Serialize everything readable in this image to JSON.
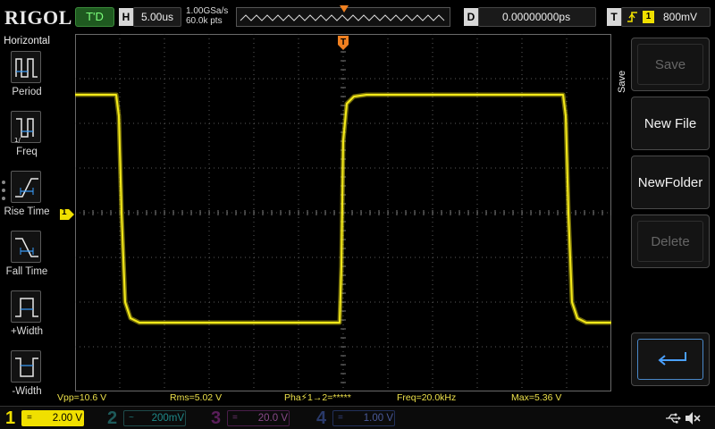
{
  "brand": {
    "logo": "RIGOL"
  },
  "topbar": {
    "run_state": "T'D",
    "timebase_tag": "H",
    "timebase_value": "5.00us",
    "sample_rate": "1.00GSa/s",
    "memory_depth": "60.0k pts",
    "delay_tag": "D",
    "delay_value": "0.00000000ps",
    "trigger_tag": "T",
    "trigger_source": "1",
    "trigger_level": "800mV"
  },
  "horizontal_menu": {
    "title": "Horizontal",
    "items": [
      {
        "label": "Period",
        "icon": "period-icon"
      },
      {
        "label": "Freq",
        "icon": "freq-icon"
      },
      {
        "label": "Rise Time",
        "icon": "rise-time-icon"
      },
      {
        "label": "Fall Time",
        "icon": "fall-time-icon"
      },
      {
        "label": "+Width",
        "icon": "pos-width-icon"
      },
      {
        "label": "-Width",
        "icon": "neg-width-icon"
      }
    ]
  },
  "save_menu": {
    "title": "Save",
    "buttons": [
      {
        "label": "Save",
        "enabled": false
      },
      {
        "label": "New File",
        "enabled": true
      },
      {
        "label": "NewFolder",
        "enabled": true
      },
      {
        "label": "Delete",
        "enabled": false
      }
    ],
    "return_icon": "return-arrow-icon"
  },
  "markers": {
    "channel1": "1",
    "trigger_pos": "T"
  },
  "measurements": [
    {
      "label": "Vpp=10.6 V"
    },
    {
      "label": "Rms=5.02 V"
    },
    {
      "label": "Pha⚡1→2=*****"
    },
    {
      "label": "Freq=20.0kHz"
    },
    {
      "label": "Max=5.36 V"
    }
  ],
  "channels": [
    {
      "num": "1",
      "coupling": "=",
      "scale": "2.00 V",
      "color": "#f0e000",
      "active": true
    },
    {
      "num": "2",
      "coupling": "~",
      "scale": "200mV",
      "color": "#1e9a9a",
      "active": false
    },
    {
      "num": "3",
      "coupling": "=",
      "scale": "20.0 V",
      "color": "#c020c0",
      "active": false
    },
    {
      "num": "4",
      "coupling": "=",
      "scale": "1.00 V",
      "color": "#3a6ad0",
      "active": false
    }
  ],
  "colors": {
    "trace": "#f5ea1a",
    "trigger_marker": "#f08020",
    "grid": "#5a5a5a",
    "run_state_bg": "#1f5a20"
  }
}
